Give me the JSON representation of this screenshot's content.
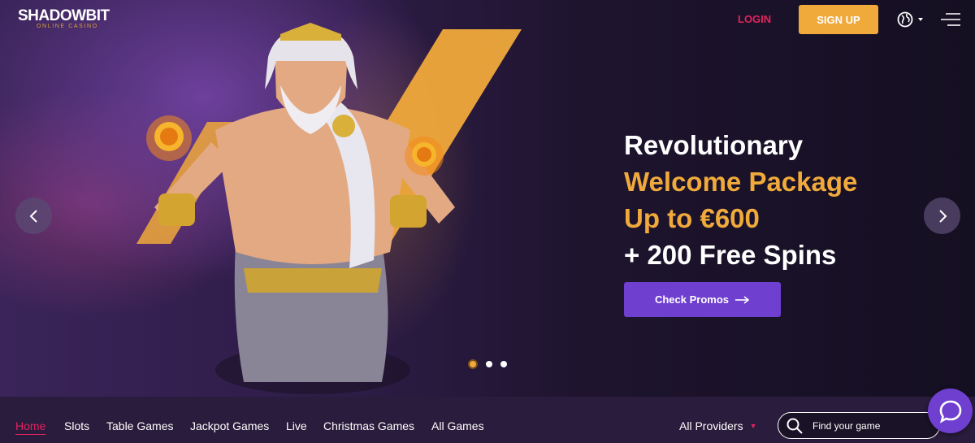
{
  "header": {
    "logo_main": "SHADOWBIT",
    "logo_sub": "ONLINE CASINO",
    "login_label": "LOGIN",
    "signup_label": "SIGN UP",
    "language_icon": "globe-icon",
    "menu_icon": "hamburger-menu-icon"
  },
  "hero": {
    "line1": "Revolutionary",
    "line2": "Welcome Package",
    "line3": "Up to €600",
    "line4": "+ 200 Free Spins",
    "cta_label": "Check Promos",
    "cta_icon": "arrow-right-icon",
    "prev_icon": "chevron-left-icon",
    "next_icon": "chevron-right-icon",
    "slides_total": 3,
    "active_slide": 1
  },
  "nav": {
    "categories": [
      "Home",
      "Slots",
      "Table Games",
      "Jackpot Games",
      "Live",
      "Christmas Games",
      "All Games"
    ],
    "active": "Home",
    "providers_label": "All Providers",
    "search_placeholder": "Find your game"
  },
  "colors": {
    "accent_orange": "#f0a93b",
    "accent_purple": "#6f3fd0",
    "accent_red": "#e0245e",
    "background": "#1a1226"
  },
  "chat_icon": "chat-bubble-icon"
}
